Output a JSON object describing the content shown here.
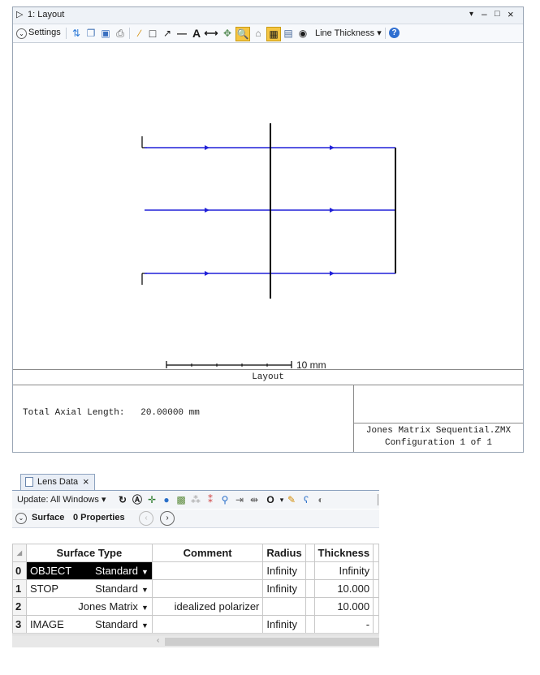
{
  "layout_window": {
    "title": "1: Layout",
    "controls": [
      "▾",
      "–",
      "□",
      "×"
    ],
    "toolbar": {
      "settings_label": "Settings",
      "line_thickness_label": "Line Thickness"
    },
    "scale_bar_label": "10 mm",
    "plot_title": "Layout",
    "total_axial_length": "Total Axial Length:   20.00000 mm",
    "file_name": "Jones Matrix Sequential.ZMX",
    "configuration": "Configuration 1 of 1",
    "colors": {
      "ray": "#2020d8",
      "lens": "#000000",
      "accent": "#f5c542"
    }
  },
  "lens_window": {
    "tab_label": "Lens Data",
    "update_label": "Update: All Windows",
    "surface_label": "Surface",
    "properties_label": "0 Properties",
    "columns": [
      "Surface Type",
      "Comment",
      "Radius",
      "Thickness"
    ],
    "rows": [
      {
        "num": "0",
        "name": "OBJECT",
        "type": "Standard",
        "comment": "",
        "radius": "Infinity",
        "thickness": "Infinity"
      },
      {
        "num": "1",
        "name": "STOP",
        "type": "Standard",
        "comment": "",
        "radius": "Infinity",
        "thickness": "10.000"
      },
      {
        "num": "2",
        "name": "",
        "type": "Jones Matrix",
        "comment": "idealized polarizer",
        "radius": "",
        "thickness": "10.000"
      },
      {
        "num": "3",
        "name": "IMAGE",
        "type": "Standard",
        "comment": "",
        "radius": "Infinity",
        "thickness": "-"
      }
    ]
  }
}
